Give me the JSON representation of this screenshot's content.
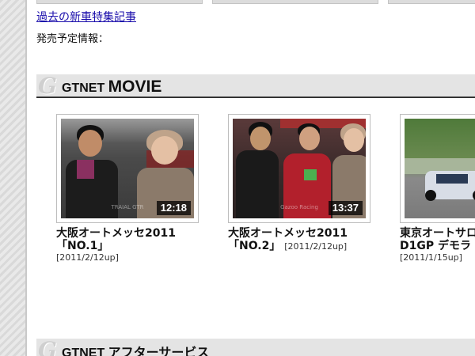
{
  "links": {
    "past_feature": "過去の新車特集記事",
    "release_label": "発売予定情報："
  },
  "sections": {
    "movie": {
      "brand": "GTNET",
      "name": "MOVIE",
      "logo": "G"
    },
    "after_service": {
      "brand": "GTNET",
      "name": "アフターサービス",
      "logo": "G"
    }
  },
  "videos": [
    {
      "line1": "大阪オートメッセ2011",
      "line2": "「NO.1」",
      "date": "[2011/2/12up]",
      "duration": "12:18"
    },
    {
      "line1": "大阪オートメッセ2011",
      "line2": "「NO.2」",
      "date": "[2011/2/12up]",
      "duration": "13:37"
    },
    {
      "line1": "東京オートサロ",
      "line2": "D1GP デモラ",
      "date": "[2011/1/15up]",
      "duration": ""
    }
  ],
  "icons": {
    "section_logo": "gtnet-g-logo-icon",
    "play": "video-thumbnail"
  },
  "colors": {
    "link": "#1a0dab",
    "section_bar": "#e4e4e4",
    "gutter": "#d9d9d9"
  }
}
